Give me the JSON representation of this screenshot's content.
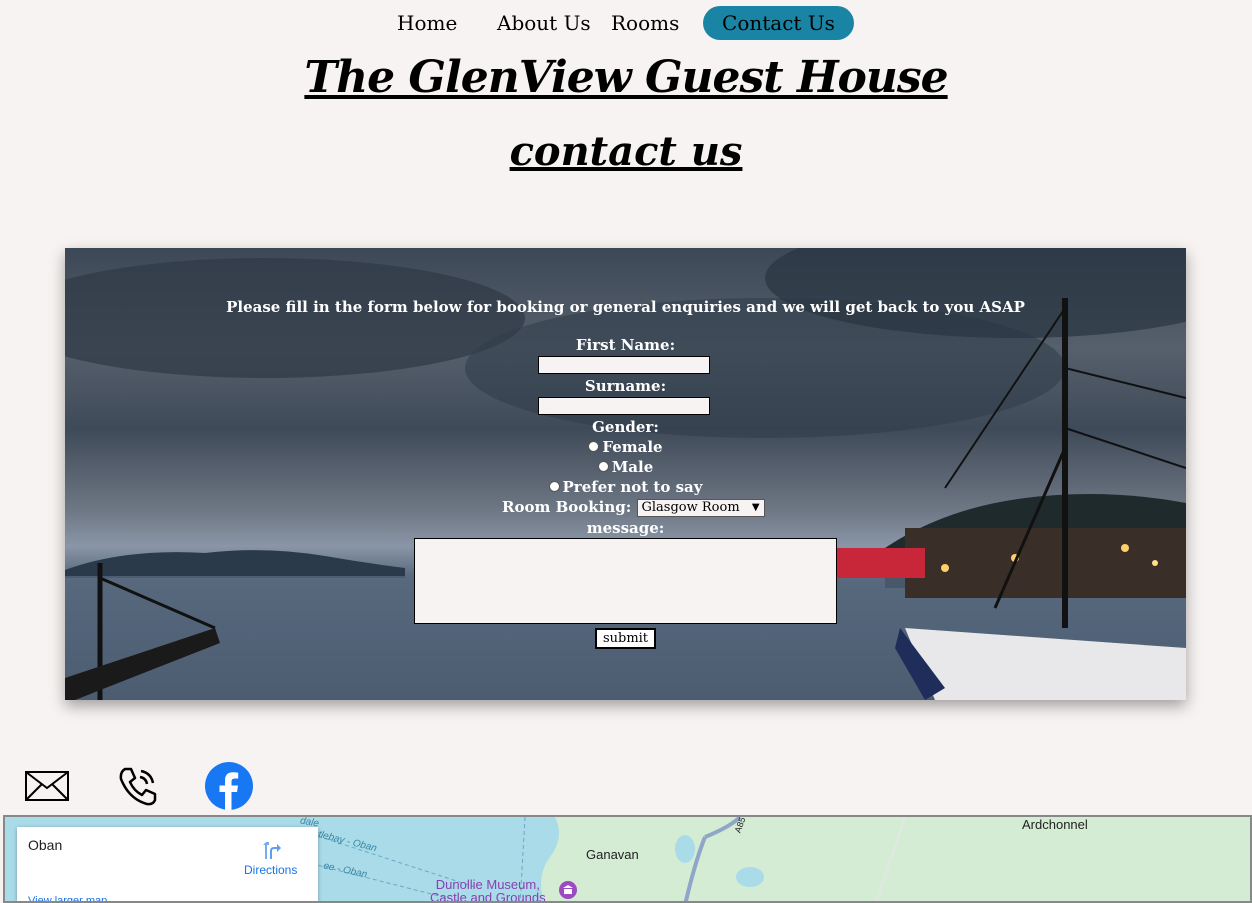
{
  "nav": {
    "items": [
      "Home",
      "About Us",
      "Rooms",
      "Contact Us"
    ],
    "active": "Contact Us",
    "active_color": "#1a84a4"
  },
  "title": "The GlenView Guest House",
  "subtitle": "contact us",
  "form": {
    "intro": "Please fill in the form below for booking or general enquiries and we will get back to you ASAP",
    "first_name_label": "First Name:",
    "first_name_value": "",
    "surname_label": "Surname:",
    "surname_value": "",
    "gender_label": "Gender:",
    "gender_options": [
      "Female",
      "Male",
      "Prefer not to say"
    ],
    "room_label": "Room Booking:",
    "room_selected": "Glasgow Room",
    "message_label": "message:",
    "message_value": "",
    "submit_label": "submit"
  },
  "contact_icons": [
    "envelope-icon",
    "phone-icon",
    "facebook-icon"
  ],
  "map": {
    "place": "Oban",
    "directions": "Directions",
    "larger_map": "View larger map",
    "labels": {
      "ganavan": "Ganavan",
      "ardchonnel": "Ardchonnel",
      "museum_line1": "Dunollie Museum,",
      "museum_line2": "Castle and Grounds",
      "road": "A85",
      "ferry1": "astlebay - Oban",
      "ferry2": "ee - Oban",
      "ferry3": "dale"
    }
  }
}
